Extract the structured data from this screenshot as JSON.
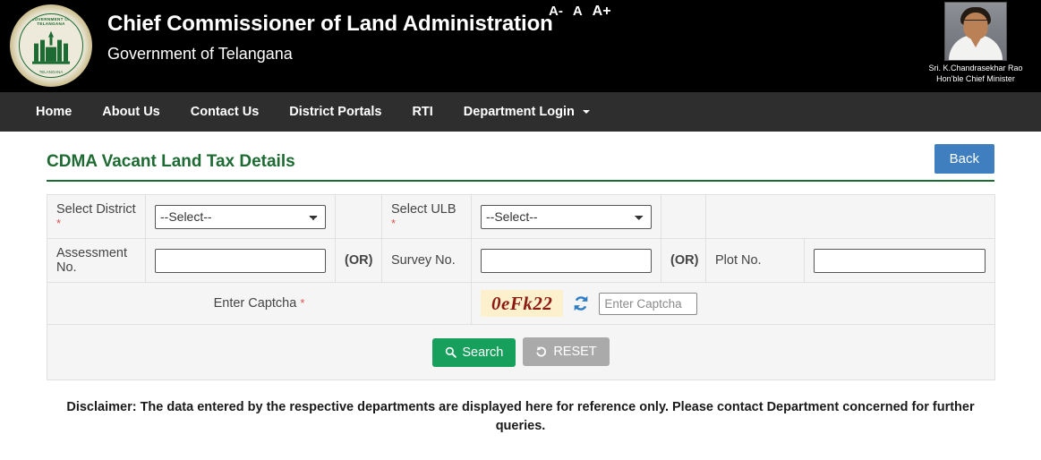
{
  "header": {
    "title": "Chief Commissioner of Land Administration",
    "subtitle": "Government of Telangana",
    "emblem_top_text": "GOVERNMENT OF TELANGANA",
    "emblem_bottom_text": "TELANGANA",
    "font_size_controls": {
      "decrease": "A-",
      "normal": "A",
      "increase": "A+"
    },
    "chief_minister": {
      "name": "Sri. K.Chandrasekhar Rao",
      "role": "Hon'ble Chief Minister"
    }
  },
  "nav": {
    "items": [
      {
        "label": "Home",
        "has_caret": false
      },
      {
        "label": "About Us",
        "has_caret": false
      },
      {
        "label": "Contact Us",
        "has_caret": false
      },
      {
        "label": "District Portals",
        "has_caret": false
      },
      {
        "label": "RTI",
        "has_caret": false
      },
      {
        "label": "Department Login",
        "has_caret": true
      }
    ]
  },
  "page": {
    "title": "CDMA Vacant Land Tax Details",
    "back_label": "Back",
    "accent_color": "#1d6b32",
    "back_color": "#3f7fbf"
  },
  "form": {
    "select_district": {
      "label": "Select District",
      "required_mark": "*",
      "value": "--Select--",
      "options": [
        "--Select--"
      ]
    },
    "select_ulb": {
      "label": "Select ULB",
      "required_mark": "*",
      "value": "--Select--",
      "options": [
        "--Select--"
      ]
    },
    "assessment_no": {
      "label": "Assessment No.",
      "value": "",
      "placeholder": ""
    },
    "survey_no": {
      "label": "Survey No.",
      "value": "",
      "placeholder": ""
    },
    "plot_no": {
      "label": "Plot No.",
      "value": "",
      "placeholder": ""
    },
    "or_separator": "(OR)",
    "captcha": {
      "label": "Enter Captcha",
      "required_mark": "*",
      "image_text": "0eFk22",
      "input_value": "",
      "input_placeholder": "Enter Captcha",
      "refresh_icon": "refresh-icon",
      "image_bg_color": "#fdf1cd",
      "image_text_color": "#8b1a12"
    },
    "buttons": {
      "search": {
        "label": "Search",
        "icon": "search-icon",
        "color": "#16a05c"
      },
      "reset": {
        "label": "RESET",
        "icon": "undo-icon",
        "color": "#aaaaaa"
      }
    }
  },
  "disclaimer": "Disclaimer: The data entered by the respective departments are displayed here for reference only. Please contact Department concerned for further queries."
}
